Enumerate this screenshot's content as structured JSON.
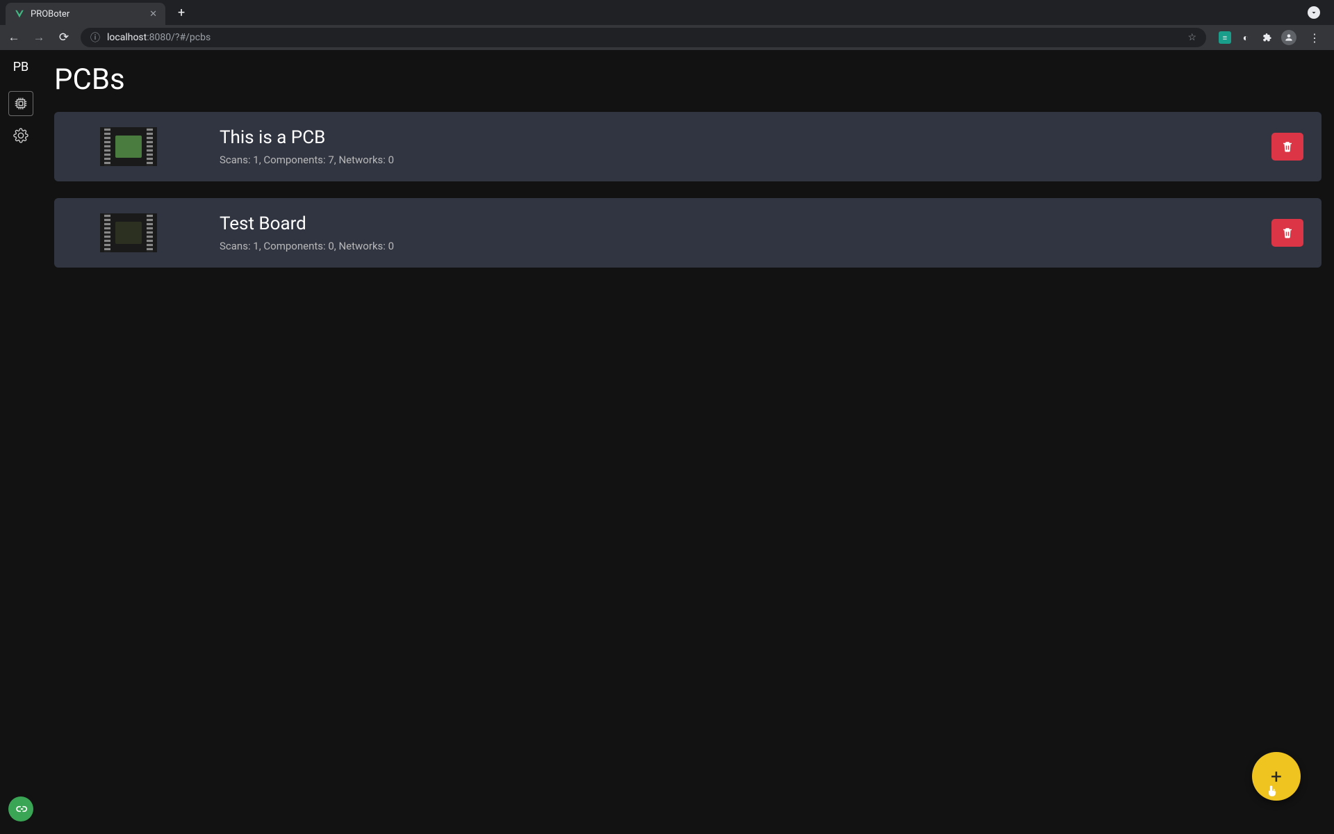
{
  "browser": {
    "tab_title": "PROBoter",
    "url_host": "localhost",
    "url_port": ":8080",
    "url_path": "/?#/pcbs"
  },
  "sidebar": {
    "logo": "PB"
  },
  "page": {
    "title": "PCBs"
  },
  "pcbs": [
    {
      "name": "This is a PCB",
      "stats": "Scans: 1, Components: 7, Networks: 0",
      "chip_style": "green"
    },
    {
      "name": "Test Board",
      "stats": "Scans: 1, Components: 0, Networks: 0",
      "chip_style": "dark"
    }
  ]
}
